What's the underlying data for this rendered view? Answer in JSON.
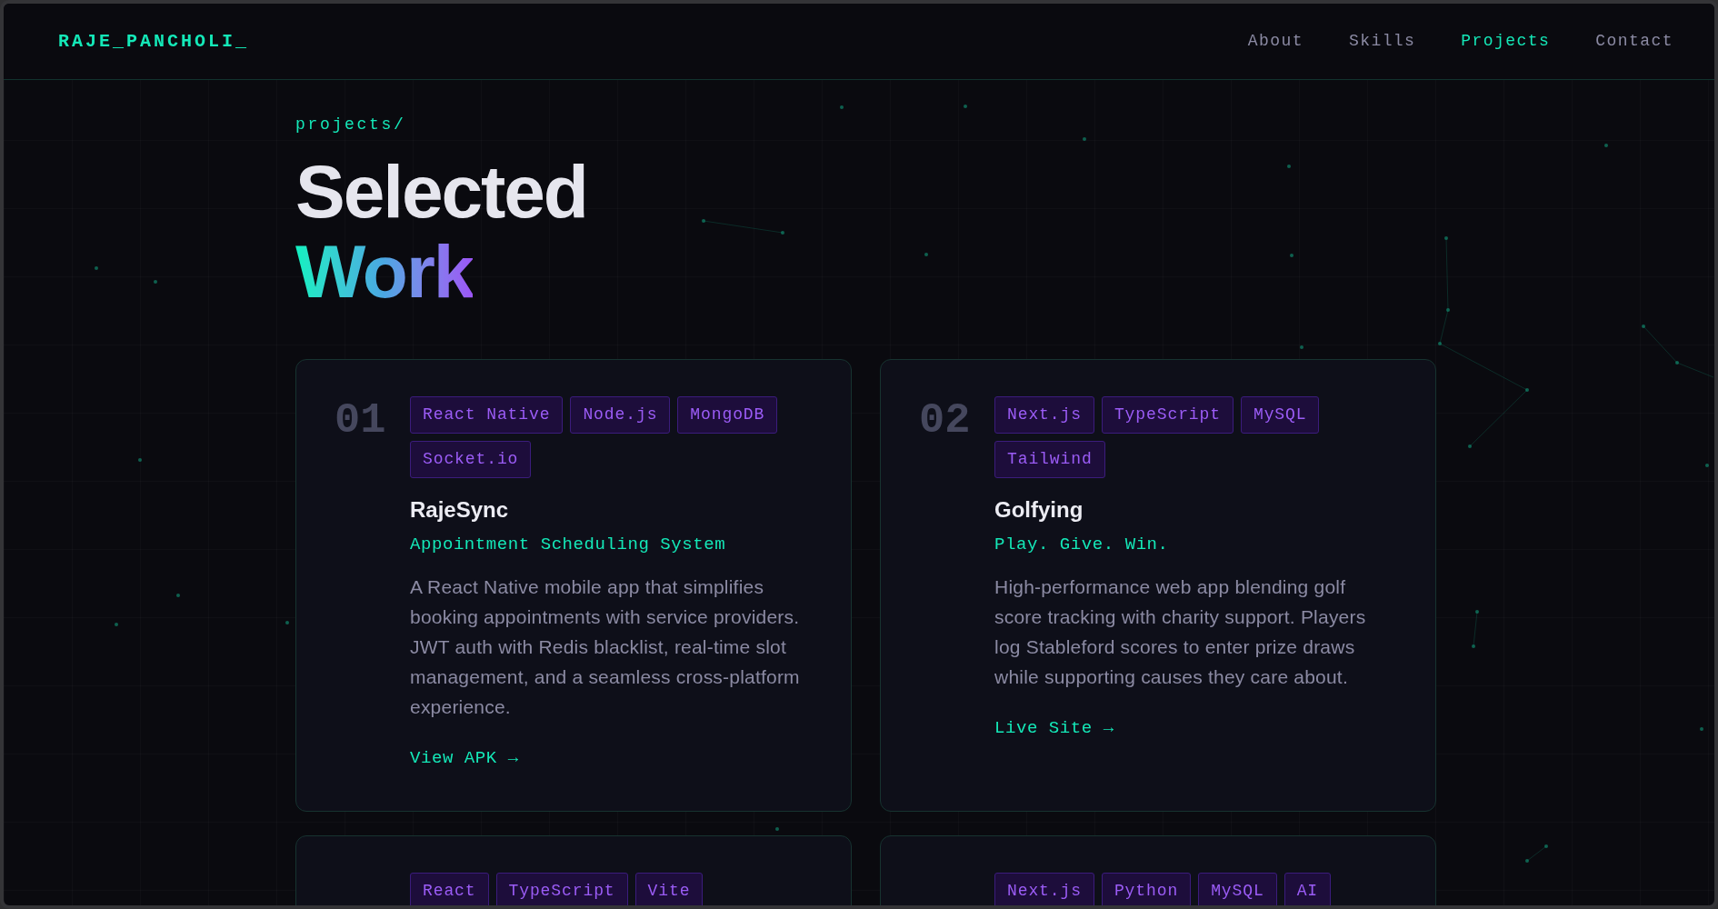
{
  "header": {
    "logo": "RAJE_PANCHOLI_",
    "nav": [
      {
        "label": "About",
        "selected": false
      },
      {
        "label": "Skills",
        "selected": false
      },
      {
        "label": "Projects",
        "selected": true
      },
      {
        "label": "Contact",
        "selected": false
      }
    ]
  },
  "section": {
    "eyebrow": "projects/",
    "title": "Selected",
    "title_highlight": "Work"
  },
  "projects": [
    {
      "number": "01",
      "tags": [
        "React Native",
        "Node.js",
        "MongoDB",
        "Socket.io"
      ],
      "name": "RajeSync",
      "tagline": "Appointment Scheduling System",
      "description": "A React Native mobile app that simplifies booking appointments with service providers. JWT auth with Redis blacklist, real-time slot management, and a seamless cross-platform experience.",
      "link": "View APK →"
    },
    {
      "number": "02",
      "tags": [
        "Next.js",
        "TypeScript",
        "MySQL",
        "Tailwind"
      ],
      "name": "Golfying",
      "tagline": "Play. Give. Win.",
      "description": "High-performance web app blending golf score tracking with charity support. Players log Stableford scores to enter prize draws while supporting causes they care about.",
      "link": "Live Site →"
    },
    {
      "tags": [
        "React",
        "TypeScript",
        "Vite"
      ]
    },
    {
      "tags": [
        "Next.js",
        "Python",
        "MySQL",
        "AI"
      ]
    }
  ]
}
